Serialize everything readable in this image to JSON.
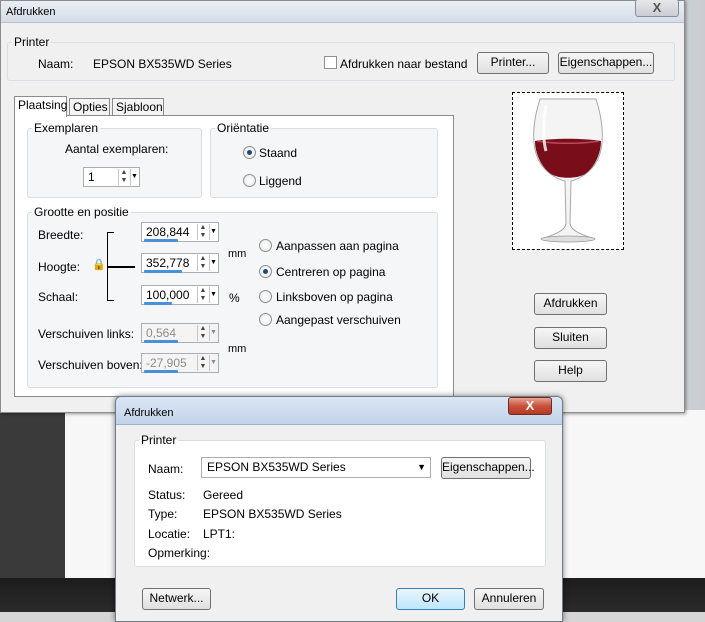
{
  "main": {
    "title": "Afdrukken",
    "close": "X",
    "printer": {
      "legend": "Printer",
      "name_label": "Naam:",
      "name_value": "EPSON BX535WD Series",
      "to_file_label": "Afdrukken naar bestand",
      "printer_btn": "Printer...",
      "props_btn": "Eigenschappen..."
    },
    "tabs": [
      "Plaatsing",
      "Opties",
      "Sjabloon"
    ],
    "copies": {
      "legend": "Exemplaren",
      "count_label": "Aantal exemplaren:",
      "count_value": "1"
    },
    "orientation": {
      "legend": "Oriëntatie",
      "portrait": "Staand",
      "landscape": "Liggend",
      "selected": "Staand"
    },
    "size": {
      "legend": "Grootte en positie",
      "width_label": "Breedte:",
      "width_value": "208,844",
      "height_label": "Hoogte:",
      "height_value": "352,778",
      "scale_label": "Schaal:",
      "scale_value": "100,000",
      "unit_mm": "mm",
      "unit_pct": "%",
      "shift_left_label": "Verschuiven links:",
      "shift_left_value": "0,564",
      "shift_top_label": "Verschuiven boven:",
      "shift_top_value": "-27,905",
      "unit_mm2": "mm"
    },
    "position": {
      "fit": "Aanpassen aan pagina",
      "center": "Centreren op pagina",
      "topleft": "Linksboven op pagina",
      "custom": "Aangepast verschuiven",
      "selected": "Centreren op pagina"
    },
    "buttons": {
      "print": "Afdrukken",
      "close": "Sluiten",
      "help": "Help"
    }
  },
  "dialog": {
    "title": "Afdrukken",
    "close": "X",
    "printer": {
      "legend": "Printer",
      "name_label": "Naam:",
      "name_value": "EPSON BX535WD Series",
      "props_btn": "Eigenschappen...",
      "status_label": "Status:",
      "status_value": "Gereed",
      "type_label": "Type:",
      "type_value": "EPSON BX535WD Series",
      "location_label": "Locatie:",
      "location_value": "LPT1:",
      "comment_label": "Opmerking:",
      "comment_value": ""
    },
    "buttons": {
      "network": "Netwerk...",
      "ok": "OK",
      "cancel": "Annuleren"
    }
  },
  "colors": {
    "accent": "#4a90d9",
    "close_red": "#c8513b",
    "wine": "#7a0d1a"
  },
  "icons": [
    "lock-icon",
    "spin-arrows-icon",
    "dropdown-arrow-icon",
    "wine-glass-image"
  ]
}
